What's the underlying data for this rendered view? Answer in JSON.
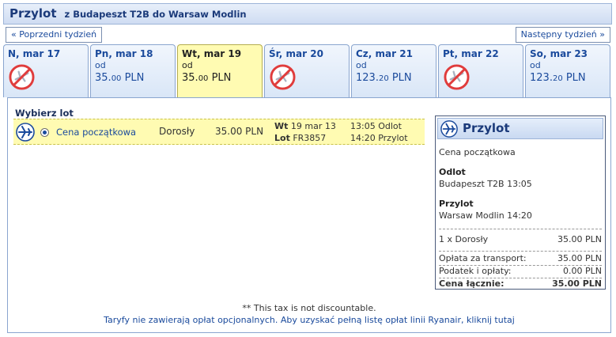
{
  "header": {
    "title": "Przylot",
    "subtitle": "z Budapeszt T2B do Warsaw Modlin"
  },
  "nav": {
    "prev_week": "« Poprzedni tydzień",
    "next_week": "Następny tydzień »"
  },
  "days": [
    {
      "name": "N, mar 17",
      "available": false
    },
    {
      "name": "Pn, mar 18",
      "od": "od",
      "price_int": "35.",
      "price_dec": "00",
      "currency": "PLN",
      "available": true
    },
    {
      "name": "Wt, mar 19",
      "od": "od",
      "price_int": "35.",
      "price_dec": "00",
      "currency": "PLN",
      "available": true,
      "selected": true
    },
    {
      "name": "Śr, mar 20",
      "available": false
    },
    {
      "name": "Cz, mar 21",
      "od": "od",
      "price_int": "123.",
      "price_dec": "20",
      "currency": "PLN",
      "available": true
    },
    {
      "name": "Pt, mar 22",
      "available": false
    },
    {
      "name": "So, mar 23",
      "od": "od",
      "price_int": "123.",
      "price_dec": "20",
      "currency": "PLN",
      "available": true
    }
  ],
  "select": {
    "title": "Wybierz lot",
    "flight": {
      "fare": "Cena początkowa",
      "pax": "Dorosły",
      "price": "35.00 PLN",
      "day_label": "Wt",
      "date": "19 mar 13",
      "flight_label": "Lot",
      "flight_no": "FR3857",
      "dep_time": "13:05",
      "dep_label": "Odlot",
      "arr_time": "14:20",
      "arr_label": "Przylot"
    }
  },
  "summary": {
    "title": "Przylot",
    "fare": "Cena początkowa",
    "dep_label": "Odlot",
    "dep_value": "Budapeszt T2B 13:05",
    "arr_label": "Przylot",
    "arr_value": "Warsaw Modlin 14:20",
    "pax_label": "1 x Dorosły",
    "pax_value": "35.00 PLN",
    "transport_label": "Opłata za transport:",
    "transport_value": "35.00 PLN",
    "tax_label": "Podatek i opłaty:",
    "tax_value": "0.00 PLN",
    "total_label": "Cena łącznie:",
    "total_value": "35.00 PLN"
  },
  "footer": {
    "note": "** This tax is not discountable.",
    "link": "Taryfy nie zawierają opłat opcjonalnych. Aby uzyskać pełną listę opłat linii Ryanair, kliknij tutaj"
  },
  "icons": {
    "plane": "plane-icon",
    "no_flight": "no-flight-icon"
  },
  "colors": {
    "accent": "#1a4a9c",
    "selected": "#fffbb2",
    "no_flight": "#e03c3c"
  }
}
